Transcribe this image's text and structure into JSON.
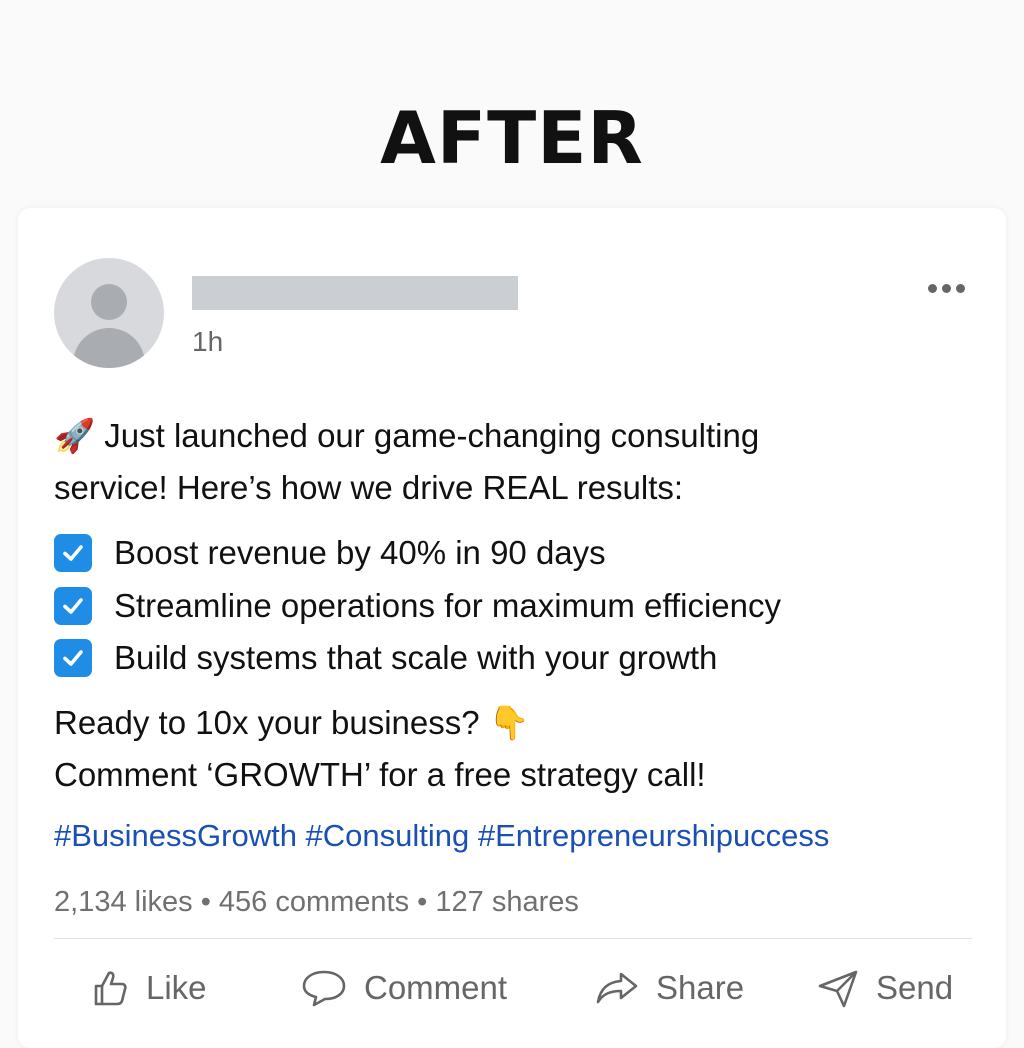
{
  "heading": "AFTER",
  "post": {
    "time": "1h",
    "intro_emoji": "🚀",
    "intro_line1": " Just launched our game-changing consulting",
    "intro_line2": "service! Here’s how we drive REAL results:",
    "checklist": [
      "Boost revenue by 40% in 90 days",
      "Streamline operations for maximum efficiency",
      "Build systems that scale with your growth"
    ],
    "cta_line1": "Ready to 10x your business? ",
    "cta_emoji": "👇",
    "cta_line2": "Comment ‘GROWTH’ for a free strategy call!",
    "hashtags": "#BusinessGrowth #Consulting #Entrepreneurshipuccess",
    "stats": "2,134 likes • 456 comments • 127 shares"
  },
  "actions": {
    "like": "Like",
    "comment": "Comment",
    "share": "Share",
    "send": "Send"
  },
  "icons": {
    "avatar": "person-icon",
    "more": "more-horizontal-icon",
    "check": "checkbox-icon",
    "like": "thumbs-up-icon",
    "comment": "comment-bubble-icon",
    "share": "share-arrow-icon",
    "send": "paper-plane-icon"
  },
  "colors": {
    "checkbox": "#1f8ce6",
    "hashtag": "#1a4fb4",
    "muted": "#666666"
  }
}
